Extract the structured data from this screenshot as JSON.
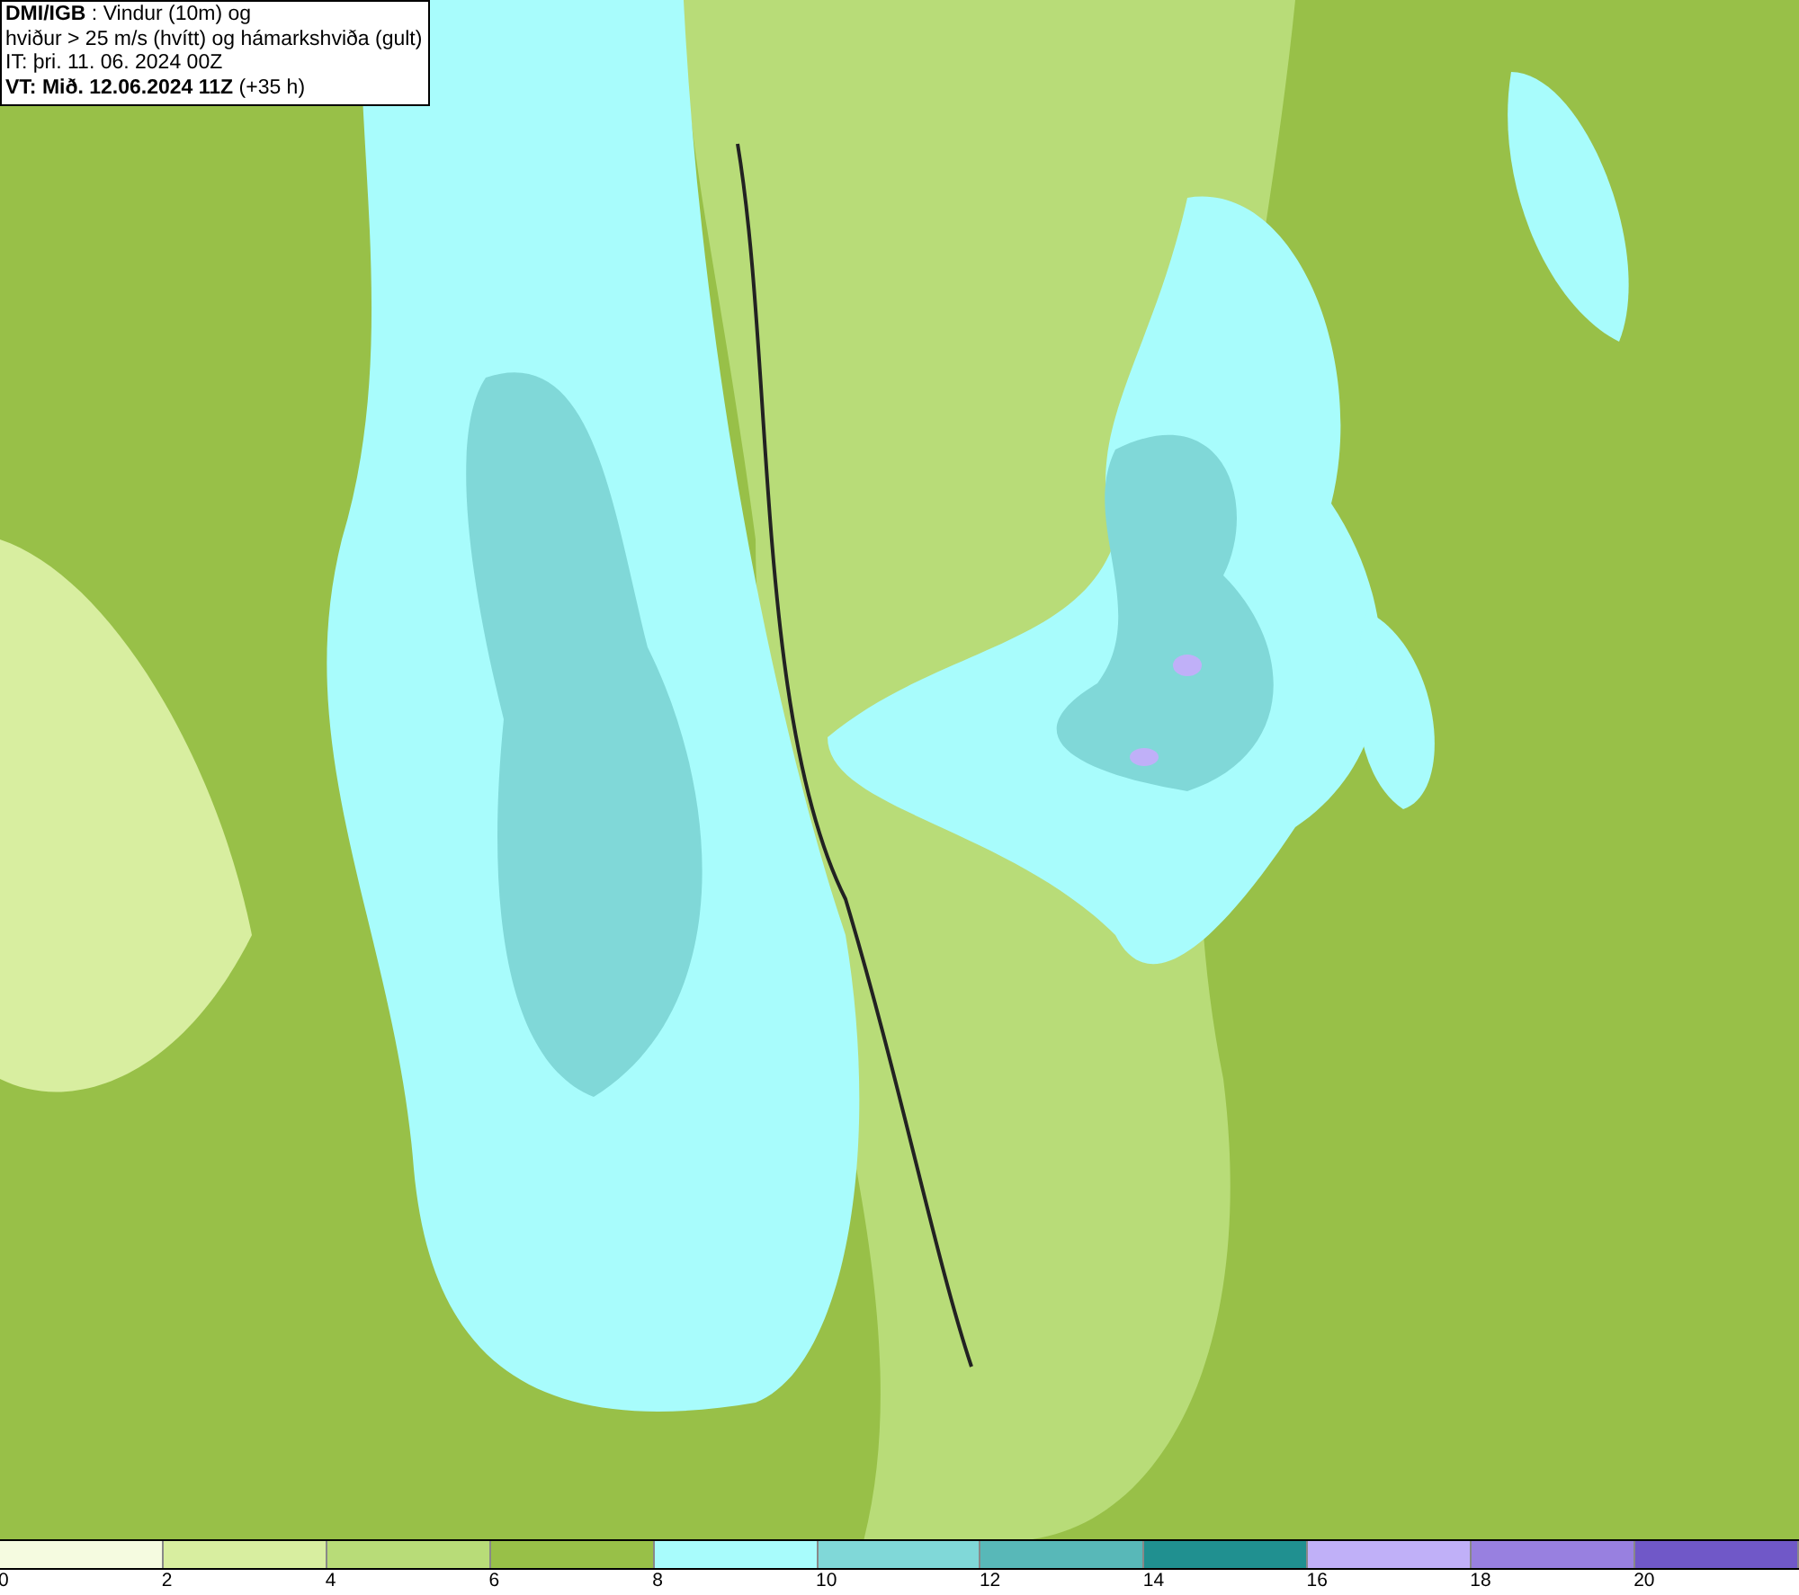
{
  "legend": {
    "lines": [
      "**DMI/IGB** : Vindur (10m) og",
      "hviður > 25 m/s (hvítt) og hámarkshviða (gult)",
      "IT: þri. 11. 06. 2024 00Z",
      "**VT: Mið. 12.06.2024 11Z** (+35 h)"
    ]
  },
  "colorbar": {
    "segments": [
      {
        "color": "#f5fbe0"
      },
      {
        "color": "#d8eea0"
      },
      {
        "color": "#b8dc78"
      },
      {
        "color": "#98c048"
      },
      {
        "color": "#a8fcfc"
      },
      {
        "color": "#80d8d8"
      },
      {
        "color": "#58b8b8"
      },
      {
        "color": "#209090"
      },
      {
        "color": "#c0b0f8"
      },
      {
        "color": "#9880e0"
      },
      {
        "color": "#7058c8"
      }
    ],
    "ticks": [
      "0",
      "2",
      "4",
      "6",
      "8",
      "10",
      "12",
      "14",
      "16",
      "18",
      "20"
    ]
  }
}
